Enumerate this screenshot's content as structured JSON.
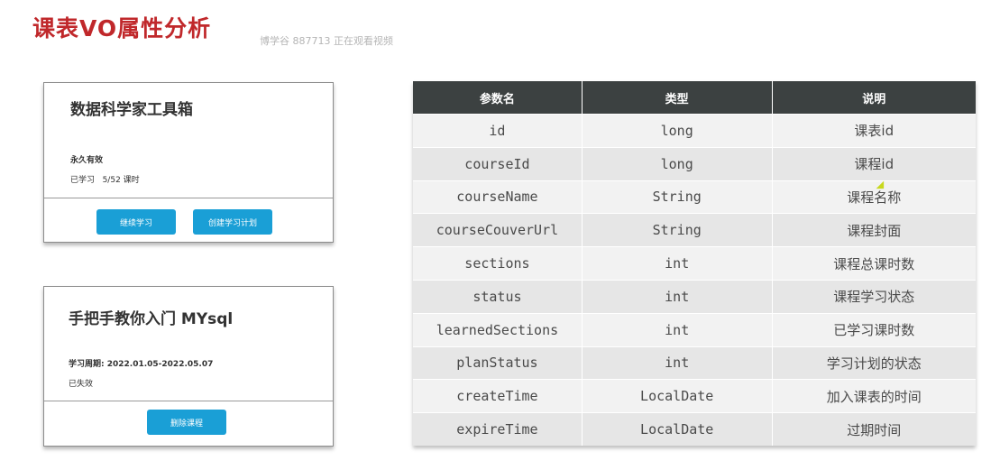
{
  "title": "课表VO属性分析",
  "watermark": "博学谷 887713 正在观看视频",
  "card1": {
    "title": "数据科学家工具箱",
    "validity": "永久有效",
    "progress": "已学习   5/52 课时",
    "btn_continue": "继续学习",
    "btn_plan": "创建学习计划"
  },
  "card2": {
    "title": "手把手教你入门 MYsql",
    "period": "学习周期: 2022.01.05-2022.05.07",
    "status": "已失效",
    "btn_delete": "删除课程"
  },
  "table": {
    "headers": [
      "参数名",
      "类型",
      "说明"
    ],
    "rows": [
      [
        "id",
        "long",
        "课表id"
      ],
      [
        "courseId",
        "long",
        "课程id"
      ],
      [
        "courseName",
        "String",
        "课程名称"
      ],
      [
        "courseCouverUrl",
        "String",
        "课程封面"
      ],
      [
        "sections",
        "int",
        "课程总课时数"
      ],
      [
        "status",
        "int",
        "课程学习状态"
      ],
      [
        "learnedSections",
        "int",
        "已学习课时数"
      ],
      [
        "planStatus",
        "int",
        "学习计划的状态"
      ],
      [
        "createTime",
        "LocalDate",
        "加入课表的时间"
      ],
      [
        "expireTime",
        "LocalDate",
        "过期时间"
      ]
    ]
  }
}
